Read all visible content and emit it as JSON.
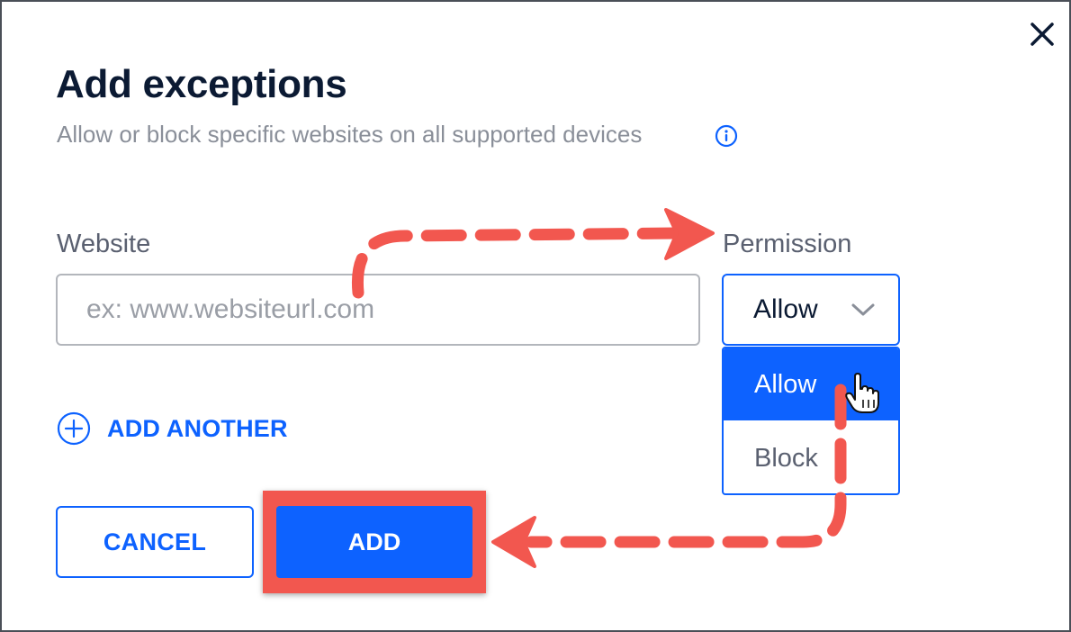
{
  "dialog": {
    "title": "Add exceptions",
    "subtitle": "Allow or block specific websites on all supported devices",
    "close_icon": "close-icon",
    "info_icon": "info-icon"
  },
  "form": {
    "website_label": "Website",
    "website_placeholder": "ex: www.websiteurl.com",
    "website_value": "",
    "permission_label": "Permission",
    "permission_selected": "Allow",
    "permission_options": [
      "Allow",
      "Block"
    ],
    "add_another_label": "ADD ANOTHER"
  },
  "buttons": {
    "cancel_label": "CANCEL",
    "add_label": "ADD"
  },
  "colors": {
    "accent": "#0d62ff",
    "title": "#0b1a33",
    "annotation": "#f2574f"
  }
}
